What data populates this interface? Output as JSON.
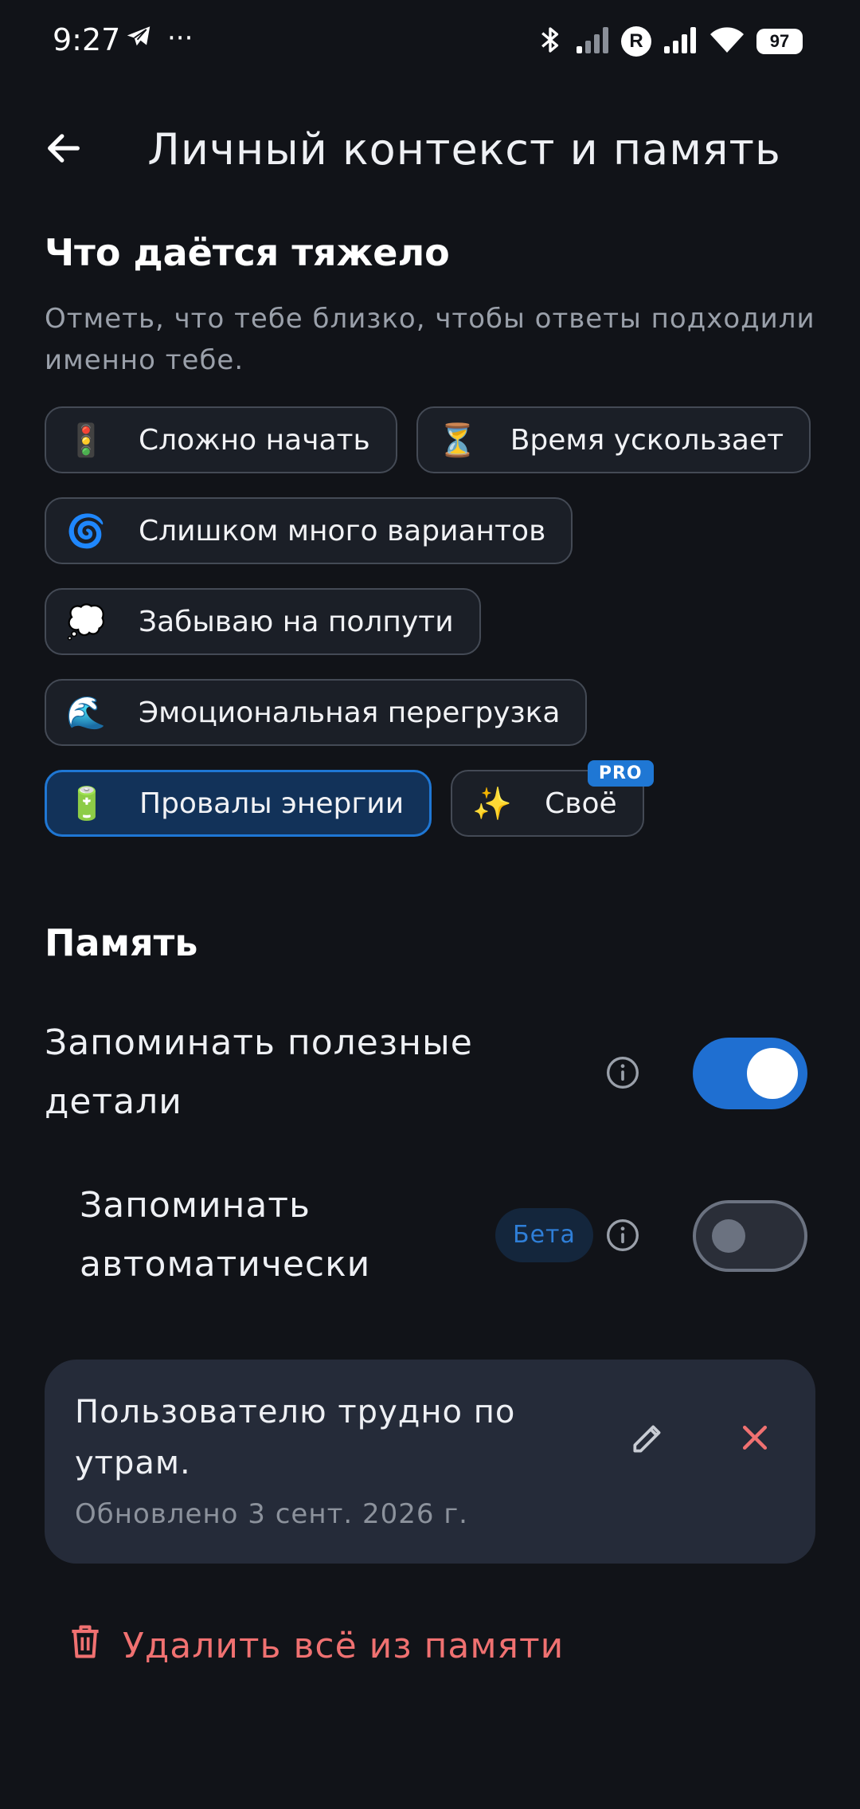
{
  "status_bar": {
    "time": "9:27",
    "more": "···",
    "battery": "97",
    "r_badge": "R"
  },
  "header": {
    "title": "Личный контекст и память"
  },
  "struggles": {
    "title": "Что даётся тяжело",
    "hint": "Отметь, что тебе близко, чтобы ответы подходили именно тебе.",
    "chips": [
      {
        "emoji": "🚦",
        "label": "Сложно начать",
        "selected": false
      },
      {
        "emoji": "⏳",
        "label": "Время ускользает",
        "selected": false
      },
      {
        "emoji": "🌀",
        "label": "Слишком много вариантов",
        "selected": false
      },
      {
        "emoji": "💭",
        "label": "Забываю на полпути",
        "selected": false
      },
      {
        "emoji": "🌊",
        "label": "Эмоциональная перегрузка",
        "selected": false
      },
      {
        "emoji": "🔋",
        "label": "Провалы энергии",
        "selected": true
      },
      {
        "emoji": "✨",
        "label": "Своё",
        "selected": false,
        "badge": "PRO"
      }
    ]
  },
  "memory": {
    "title": "Память",
    "remember_details": {
      "label_line1": "Запоминать полезные",
      "label_line2": "детали",
      "enabled": true
    },
    "remember_auto": {
      "label_line1": "Запоминать",
      "label_line2": "автоматически",
      "badge": "Бета",
      "enabled": false
    },
    "card": {
      "text_line1": "Пользователю трудно по",
      "text_line2": "утрам.",
      "updated": "Обновлено 3 сент. 2026 г."
    },
    "delete_all": "Удалить всё из памяти"
  },
  "colors": {
    "accent": "#1f77d4",
    "danger": "#f07171",
    "background": "#111318"
  }
}
